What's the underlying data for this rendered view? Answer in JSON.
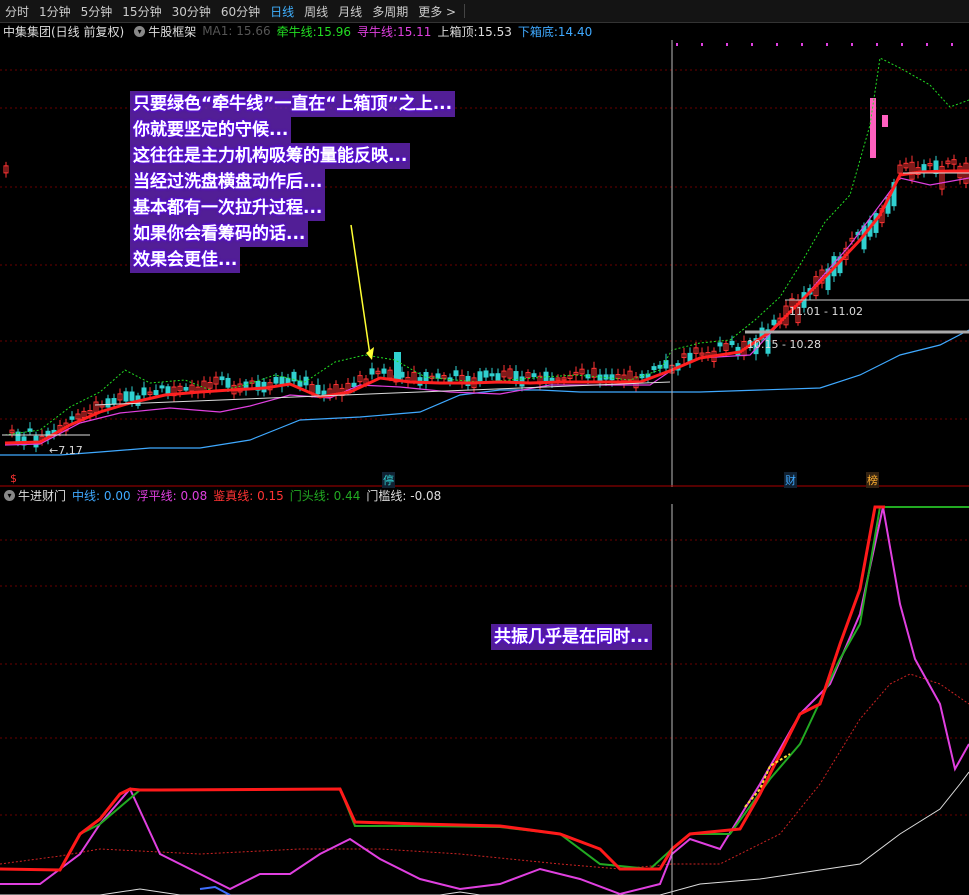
{
  "toolbar": {
    "tabs": [
      "分时",
      "1分钟",
      "5分钟",
      "15分钟",
      "30分钟",
      "60分钟",
      "日线",
      "周线",
      "月线",
      "多周期",
      "更多 >"
    ],
    "active_index": 6
  },
  "main_info": {
    "stock": "中集集团(日线 前复权)",
    "indicator": "牛股框架",
    "faded_value": "MA1: 15.66",
    "items": [
      {
        "label": "牵牛线:",
        "value": "15.96",
        "color": "#22dd22"
      },
      {
        "label": "寻牛线:",
        "value": "15.11",
        "color": "#e040e0"
      },
      {
        "label": "上箱顶:",
        "value": "15.53",
        "color": "#dddddd"
      },
      {
        "label": "下箱底:",
        "value": "14.40",
        "color": "#3fa9ff"
      }
    ]
  },
  "annotation_main": [
    "只要绿色“牵牛线”一直在“上箱顶”之上...",
    "你就要坚定的守候...",
    "这往往是主力机构吸筹的量能反映...",
    "当经过洗盘横盘动作后...",
    "基本都有一次拉升过程...",
    "如果你会看筹码的话...",
    "效果会更佳..."
  ],
  "range_labels": {
    "low": "7.17",
    "r1": "11.01 - 11.02",
    "r2": "10.15 - 10.28"
  },
  "markers": {
    "dollar": "$",
    "ting": "停",
    "cai": "财",
    "bang": "榜"
  },
  "sub_info": {
    "indicator": "牛进财门",
    "items": [
      {
        "label": "中线:",
        "value": "0.00",
        "color": "#3fa9ff"
      },
      {
        "label": "浮平线:",
        "value": "0.08",
        "color": "#e040e0"
      },
      {
        "label": "鉴真线:",
        "value": "0.15",
        "color": "#ff3333"
      },
      {
        "label": "门头线:",
        "value": "0.44",
        "color": "#22aa22"
      },
      {
        "label": "门槛线:",
        "value": "-0.08",
        "color": "#dddddd"
      }
    ]
  },
  "annotation_sub": "共振几乎是在同时...",
  "colors": {
    "up": "#ff3333",
    "down": "#30d0d0",
    "qianniu": "#22dd22",
    "xunniu": "#e040e0",
    "shangxiang": "#dddddd",
    "xiaxiang": "#3fa9ff",
    "grid": "#7a0000"
  }
}
